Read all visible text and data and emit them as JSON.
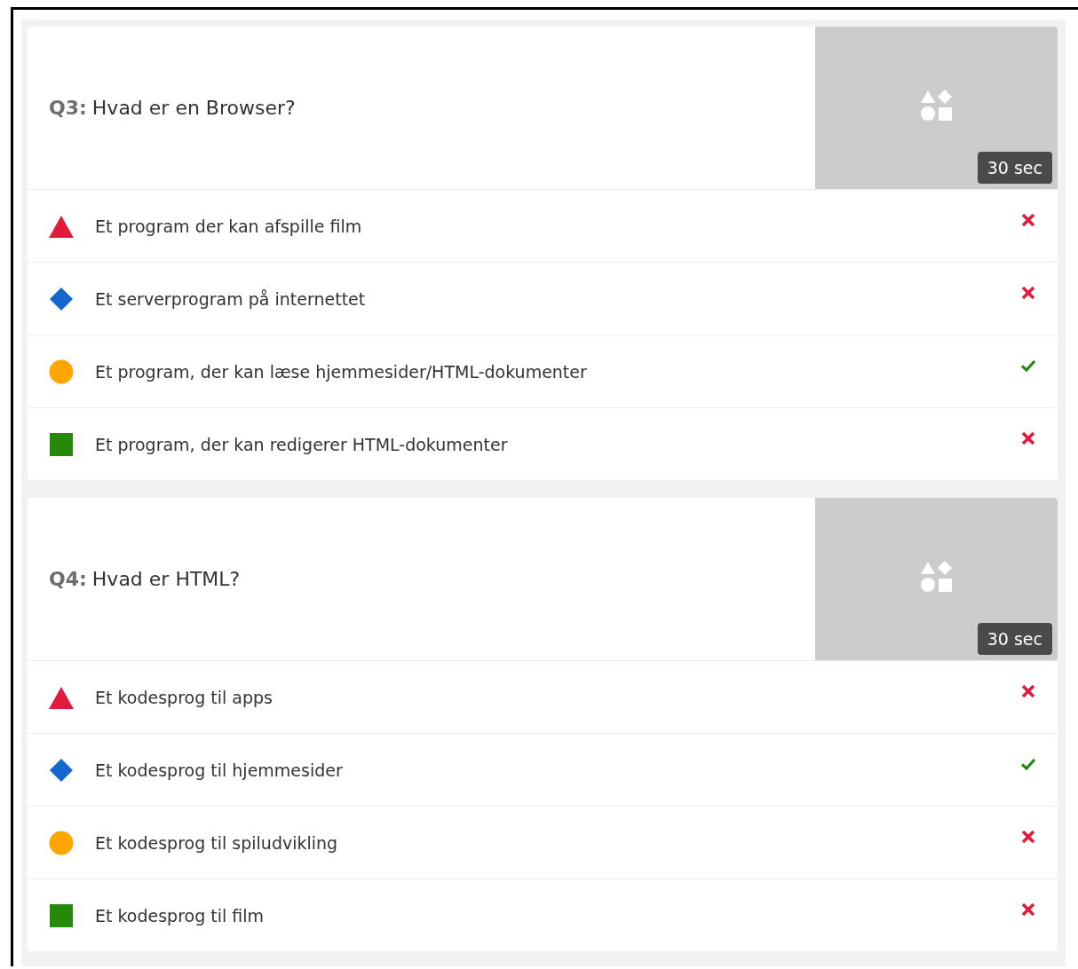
{
  "questions": [
    {
      "number": "Q3:",
      "text": "Hvad er en Browser?",
      "time": "30 sec",
      "answers": [
        {
          "kind": "triangle",
          "color": "#e21b3c",
          "text": "Et program der kan afspille film",
          "correct": false
        },
        {
          "kind": "diamond",
          "color": "#1368ce",
          "text": "Et serverprogram på internettet",
          "correct": false
        },
        {
          "kind": "circle",
          "color": "#ffa602",
          "text": "Et program, der kan læse hjemmesider/HTML-dokumenter",
          "correct": true
        },
        {
          "kind": "square",
          "color": "#26890c",
          "text": "Et program, der kan redigerer HTML-dokumenter",
          "correct": false
        }
      ]
    },
    {
      "number": "Q4:",
      "text": "Hvad er HTML?",
      "time": "30 sec",
      "answers": [
        {
          "kind": "triangle",
          "color": "#e21b3c",
          "text": "Et kodesprog til apps",
          "correct": false
        },
        {
          "kind": "diamond",
          "color": "#1368ce",
          "text": "Et kodesprog til hjemmesider",
          "correct": true
        },
        {
          "kind": "circle",
          "color": "#ffa602",
          "text": "Et kodesprog til spiludvikling",
          "correct": false
        },
        {
          "kind": "square",
          "color": "#26890c",
          "text": "Et kodesprog til film",
          "correct": false
        }
      ]
    }
  ]
}
